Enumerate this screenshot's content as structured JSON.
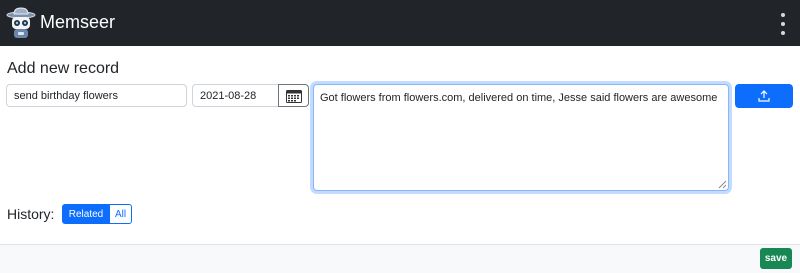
{
  "app": {
    "title": "Memseer"
  },
  "icons": {
    "logo": "robot-logo-icon",
    "menu": "kebab-menu-icon",
    "calendar": "calendar-icon",
    "upload": "upload-icon"
  },
  "form": {
    "heading": "Add new record",
    "title_value": "send birthday flowers",
    "date_value": "2021-08-28",
    "notes_value": "Got flowers from flowers.com, delivered on time, Jesse said flowers are awesome"
  },
  "history": {
    "label": "History:",
    "filters": [
      "Related",
      "All"
    ],
    "selected": "Related"
  },
  "footer": {
    "save_label": "save"
  },
  "colors": {
    "navbar": "#212529",
    "primary": "#0d6efd",
    "success": "#198754"
  }
}
